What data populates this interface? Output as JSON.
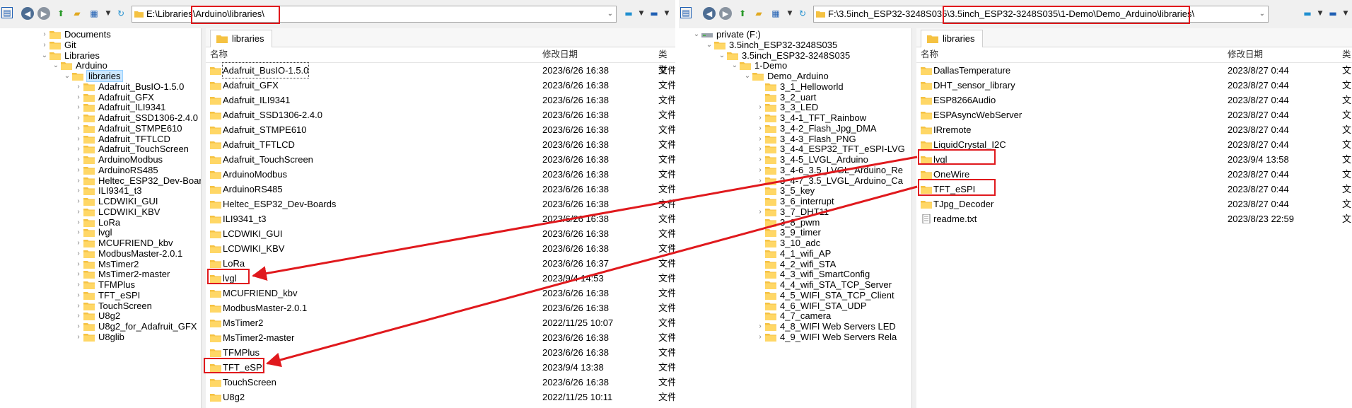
{
  "left": {
    "address": "E:\\Libraries\\Arduino\\libraries\\",
    "tab": "libraries",
    "columns": {
      "name": "名称",
      "date": "修改日期",
      "type": "类型"
    },
    "tree": [
      {
        "label": "Documents",
        "level": 2,
        "toggle": "›"
      },
      {
        "label": "Git",
        "level": 2,
        "toggle": "›"
      },
      {
        "label": "Libraries",
        "level": 2,
        "toggle": "⌄"
      },
      {
        "label": "Arduino",
        "level": 3,
        "toggle": "⌄"
      },
      {
        "label": "libraries",
        "level": 4,
        "toggle": "⌄",
        "selected": true
      },
      {
        "label": "Adafruit_BusIO-1.5.0",
        "level": 5,
        "toggle": "›"
      },
      {
        "label": "Adafruit_GFX",
        "level": 5,
        "toggle": "›"
      },
      {
        "label": "Adafruit_ILI9341",
        "level": 5,
        "toggle": "›"
      },
      {
        "label": "Adafruit_SSD1306-2.4.0",
        "level": 5,
        "toggle": "›"
      },
      {
        "label": "Adafruit_STMPE610",
        "level": 5,
        "toggle": "›"
      },
      {
        "label": "Adafruit_TFTLCD",
        "level": 5,
        "toggle": "›"
      },
      {
        "label": "Adafruit_TouchScreen",
        "level": 5,
        "toggle": "›"
      },
      {
        "label": "ArduinoModbus",
        "level": 5,
        "toggle": "›"
      },
      {
        "label": "ArduinoRS485",
        "level": 5,
        "toggle": "›"
      },
      {
        "label": "Heltec_ESP32_Dev-Boar",
        "level": 5,
        "toggle": "›"
      },
      {
        "label": "ILI9341_t3",
        "level": 5,
        "toggle": "›"
      },
      {
        "label": "LCDWIKI_GUI",
        "level": 5,
        "toggle": "›"
      },
      {
        "label": "LCDWIKI_KBV",
        "level": 5,
        "toggle": "›"
      },
      {
        "label": "LoRa",
        "level": 5,
        "toggle": "›"
      },
      {
        "label": "lvgl",
        "level": 5,
        "toggle": "›"
      },
      {
        "label": "MCUFRIEND_kbv",
        "level": 5,
        "toggle": "›"
      },
      {
        "label": "ModbusMaster-2.0.1",
        "level": 5,
        "toggle": "›"
      },
      {
        "label": "MsTimer2",
        "level": 5,
        "toggle": "›"
      },
      {
        "label": "MsTimer2-master",
        "level": 5,
        "toggle": "›"
      },
      {
        "label": "TFMPlus",
        "level": 5,
        "toggle": "›"
      },
      {
        "label": "TFT_eSPI",
        "level": 5,
        "toggle": "›"
      },
      {
        "label": "TouchScreen",
        "level": 5,
        "toggle": "›"
      },
      {
        "label": "U8g2",
        "level": 5,
        "toggle": "›"
      },
      {
        "label": "U8g2_for_Adafruit_GFX",
        "level": 5,
        "toggle": "›"
      },
      {
        "label": "U8glib",
        "level": 5,
        "toggle": "›"
      }
    ],
    "files": [
      {
        "name": "Adafruit_BusIO-1.5.0",
        "date": "2023/6/26 16:38",
        "type": "文件"
      },
      {
        "name": "Adafruit_GFX",
        "date": "2023/6/26 16:38",
        "type": "文件"
      },
      {
        "name": "Adafruit_ILI9341",
        "date": "2023/6/26 16:38",
        "type": "文件"
      },
      {
        "name": "Adafruit_SSD1306-2.4.0",
        "date": "2023/6/26 16:38",
        "type": "文件"
      },
      {
        "name": "Adafruit_STMPE610",
        "date": "2023/6/26 16:38",
        "type": "文件"
      },
      {
        "name": "Adafruit_TFTLCD",
        "date": "2023/6/26 16:38",
        "type": "文件"
      },
      {
        "name": "Adafruit_TouchScreen",
        "date": "2023/6/26 16:38",
        "type": "文件"
      },
      {
        "name": "ArduinoModbus",
        "date": "2023/6/26 16:38",
        "type": "文件"
      },
      {
        "name": "ArduinoRS485",
        "date": "2023/6/26 16:38",
        "type": "文件"
      },
      {
        "name": "Heltec_ESP32_Dev-Boards",
        "date": "2023/6/26 16:38",
        "type": "文件"
      },
      {
        "name": "ILI9341_t3",
        "date": "2023/6/26 16:38",
        "type": "文件"
      },
      {
        "name": "LCDWIKI_GUI",
        "date": "2023/6/26 16:38",
        "type": "文件"
      },
      {
        "name": "LCDWIKI_KBV",
        "date": "2023/6/26 16:38",
        "type": "文件"
      },
      {
        "name": "LoRa",
        "date": "2023/6/26 16:37",
        "type": "文件"
      },
      {
        "name": "lvgl",
        "date": "2023/9/4 14:53",
        "type": "文件"
      },
      {
        "name": "MCUFRIEND_kbv",
        "date": "2023/6/26 16:38",
        "type": "文件"
      },
      {
        "name": "ModbusMaster-2.0.1",
        "date": "2023/6/26 16:38",
        "type": "文件"
      },
      {
        "name": "MsTimer2",
        "date": "2022/11/25 10:07",
        "type": "文件"
      },
      {
        "name": "MsTimer2-master",
        "date": "2023/6/26 16:38",
        "type": "文件"
      },
      {
        "name": "TFMPlus",
        "date": "2023/6/26 16:38",
        "type": "文件"
      },
      {
        "name": "TFT_eSPI",
        "date": "2023/9/4 13:38",
        "type": "文件"
      },
      {
        "name": "TouchScreen",
        "date": "2023/6/26 16:38",
        "type": "文件"
      },
      {
        "name": "U8g2",
        "date": "2022/11/25 10:11",
        "type": "文件"
      }
    ]
  },
  "right": {
    "address": "F:\\3.5inch_ESP32-3248S035\\3.5inch_ESP32-3248S035\\1-Demo\\Demo_Arduino\\libraries\\",
    "tab": "libraries",
    "columns": {
      "name": "名称",
      "date": "修改日期",
      "type": "类"
    },
    "tree": [
      {
        "label": "private (F:)",
        "level": 1,
        "toggle": "⌄",
        "icon": "drive"
      },
      {
        "label": "3.5inch_ESP32-3248S035",
        "level": 2,
        "toggle": "⌄"
      },
      {
        "label": "3.5inch_ESP32-3248S035",
        "level": 3,
        "toggle": "⌄"
      },
      {
        "label": "1-Demo",
        "level": 4,
        "toggle": "⌄"
      },
      {
        "label": "Demo_Arduino",
        "level": 5,
        "toggle": "⌄"
      },
      {
        "label": "3_1_Helloworld",
        "level": 6,
        "toggle": ""
      },
      {
        "label": "3_2_uart",
        "level": 6,
        "toggle": ""
      },
      {
        "label": "3_3_LED",
        "level": 6,
        "toggle": "›"
      },
      {
        "label": "3_4-1_TFT_Rainbow",
        "level": 6,
        "toggle": "›"
      },
      {
        "label": "3_4-2_Flash_Jpg_DMA",
        "level": 6,
        "toggle": "›"
      },
      {
        "label": "3_4-3_Flash_PNG",
        "level": 6,
        "toggle": "›"
      },
      {
        "label": "3_4-4_ESP32_TFT_eSPI-LVG",
        "level": 6,
        "toggle": "›"
      },
      {
        "label": "3_4-5_LVGL_Arduino",
        "level": 6,
        "toggle": "›"
      },
      {
        "label": "3_4-6_3.5_LVGL_Arduino_Re",
        "level": 6,
        "toggle": "›"
      },
      {
        "label": "3_4-7_3.5_LVGL_Arduino_Ca",
        "level": 6,
        "toggle": "›"
      },
      {
        "label": "3_5_key",
        "level": 6,
        "toggle": ""
      },
      {
        "label": "3_6_interrupt",
        "level": 6,
        "toggle": ""
      },
      {
        "label": "3_7_DHT11",
        "level": 6,
        "toggle": "›"
      },
      {
        "label": "3_8_pwm",
        "level": 6,
        "toggle": ""
      },
      {
        "label": "3_9_timer",
        "level": 6,
        "toggle": ""
      },
      {
        "label": "3_10_adc",
        "level": 6,
        "toggle": ""
      },
      {
        "label": "4_1_wifi_AP",
        "level": 6,
        "toggle": ""
      },
      {
        "label": "4_2_wifi_STA",
        "level": 6,
        "toggle": ""
      },
      {
        "label": "4_3_wifi_SmartConfig",
        "level": 6,
        "toggle": ""
      },
      {
        "label": "4_4_wifi_STA_TCP_Server",
        "level": 6,
        "toggle": ""
      },
      {
        "label": "4_5_WIFI_STA_TCP_Client",
        "level": 6,
        "toggle": ""
      },
      {
        "label": "4_6_WIFI_STA_UDP",
        "level": 6,
        "toggle": ""
      },
      {
        "label": "4_7_camera",
        "level": 6,
        "toggle": ""
      },
      {
        "label": "4_8_WIFI Web Servers LED",
        "level": 6,
        "toggle": "›"
      },
      {
        "label": "4_9_WIFI Web Servers Rela",
        "level": 6,
        "toggle": "›"
      }
    ],
    "files": [
      {
        "name": "DallasTemperature",
        "date": "2023/8/27 0:44",
        "type": "文"
      },
      {
        "name": "DHT_sensor_library",
        "date": "2023/8/27 0:44",
        "type": "文"
      },
      {
        "name": "ESP8266Audio",
        "date": "2023/8/27 0:44",
        "type": "文"
      },
      {
        "name": "ESPAsyncWebServer",
        "date": "2023/8/27 0:44",
        "type": "文"
      },
      {
        "name": "IRremote",
        "date": "2023/8/27 0:44",
        "type": "文"
      },
      {
        "name": "LiquidCrystal_I2C",
        "date": "2023/8/27 0:44",
        "type": "文"
      },
      {
        "name": "lvgl",
        "date": "2023/9/4 13:58",
        "type": "文"
      },
      {
        "name": "OneWire",
        "date": "2023/8/27 0:44",
        "type": "文"
      },
      {
        "name": "TFT_eSPI",
        "date": "2023/8/27 0:44",
        "type": "文"
      },
      {
        "name": "TJpg_Decoder",
        "date": "2023/8/27 0:44",
        "type": "文"
      },
      {
        "name": "readme.txt",
        "date": "2023/8/23 22:59",
        "type": "文",
        "file": true
      }
    ]
  },
  "colors": {
    "annotation": "#e0191d",
    "folder": "#f5c242",
    "selection": "#cce8ff"
  }
}
